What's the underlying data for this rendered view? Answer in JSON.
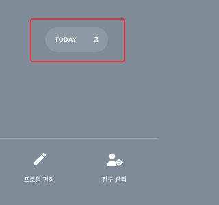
{
  "today": {
    "label": "TODAY",
    "count": "3"
  },
  "actions": {
    "edit_profile_label": "프로필 편집",
    "manage_friends_label": "친구 관리"
  },
  "colors": {
    "background": "#7f8c97",
    "highlight": "#e8303a",
    "text": "#ffffff"
  },
  "icons": {
    "edit": "pencil-icon",
    "friends": "person-settings-icon"
  }
}
